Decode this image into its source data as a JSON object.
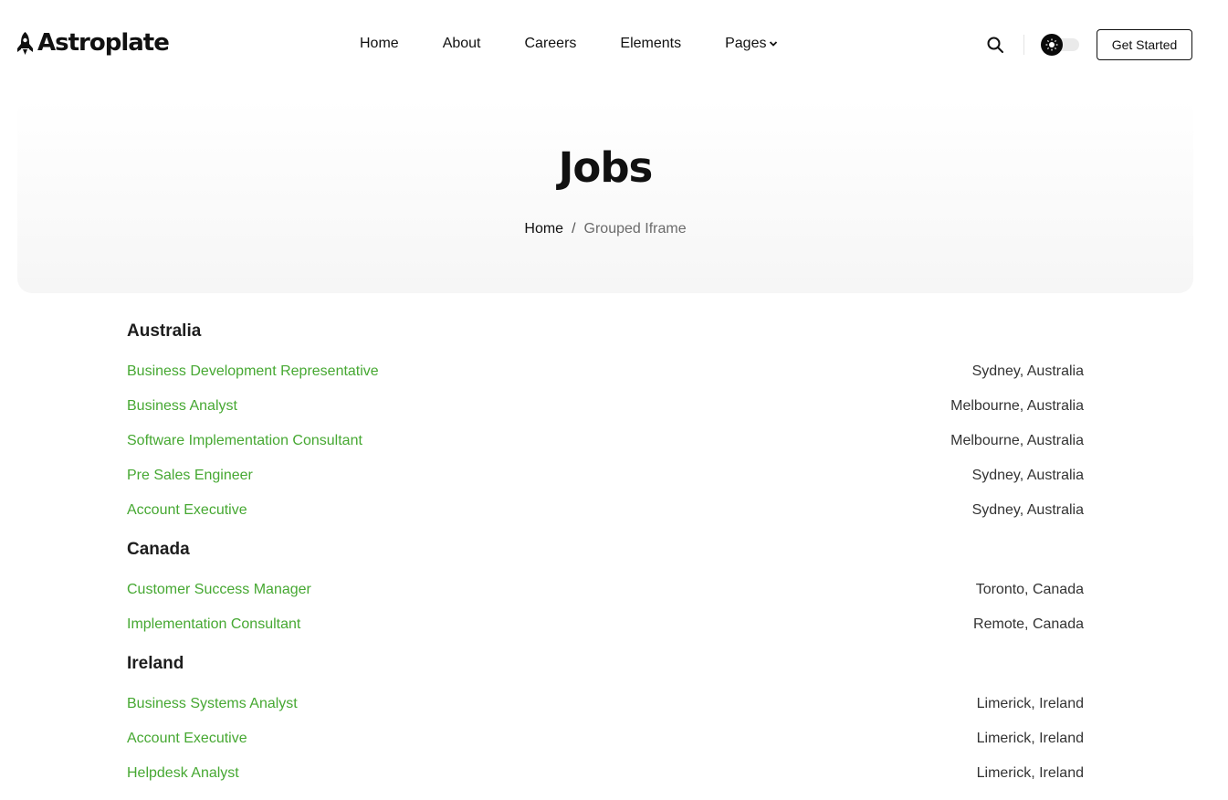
{
  "brand": {
    "name": "Astroplate",
    "icon": "rocket-icon"
  },
  "nav": {
    "items": [
      {
        "label": "Home"
      },
      {
        "label": "About"
      },
      {
        "label": "Careers"
      },
      {
        "label": "Elements"
      },
      {
        "label": "Pages"
      }
    ]
  },
  "header": {
    "search_icon": "search-icon",
    "theme_icon": "sun-icon",
    "cta_label": "Get Started"
  },
  "hero": {
    "title": "Jobs",
    "breadcrumb": {
      "home": "Home",
      "separator": "/",
      "current": "Grouped Iframe"
    }
  },
  "groups": [
    {
      "country": "Australia",
      "jobs": [
        {
          "title": "Business Development Representative",
          "location": "Sydney, Australia"
        },
        {
          "title": "Business Analyst",
          "location": "Melbourne, Australia"
        },
        {
          "title": "Software Implementation Consultant",
          "location": "Melbourne, Australia"
        },
        {
          "title": "Pre Sales Engineer",
          "location": "Sydney, Australia"
        },
        {
          "title": "Account Executive",
          "location": "Sydney, Australia"
        }
      ]
    },
    {
      "country": "Canada",
      "jobs": [
        {
          "title": "Customer Success Manager",
          "location": "Toronto, Canada"
        },
        {
          "title": "Implementation Consultant",
          "location": "Remote, Canada"
        }
      ]
    },
    {
      "country": "Ireland",
      "jobs": [
        {
          "title": "Business Systems Analyst",
          "location": "Limerick, Ireland"
        },
        {
          "title": "Account Executive",
          "location": "Limerick, Ireland"
        },
        {
          "title": "Helpdesk Analyst",
          "location": "Limerick, Ireland"
        }
      ]
    }
  ],
  "colors": {
    "link": "#46a832",
    "text": "#111111",
    "hero_bg": "#f6f6f6"
  }
}
